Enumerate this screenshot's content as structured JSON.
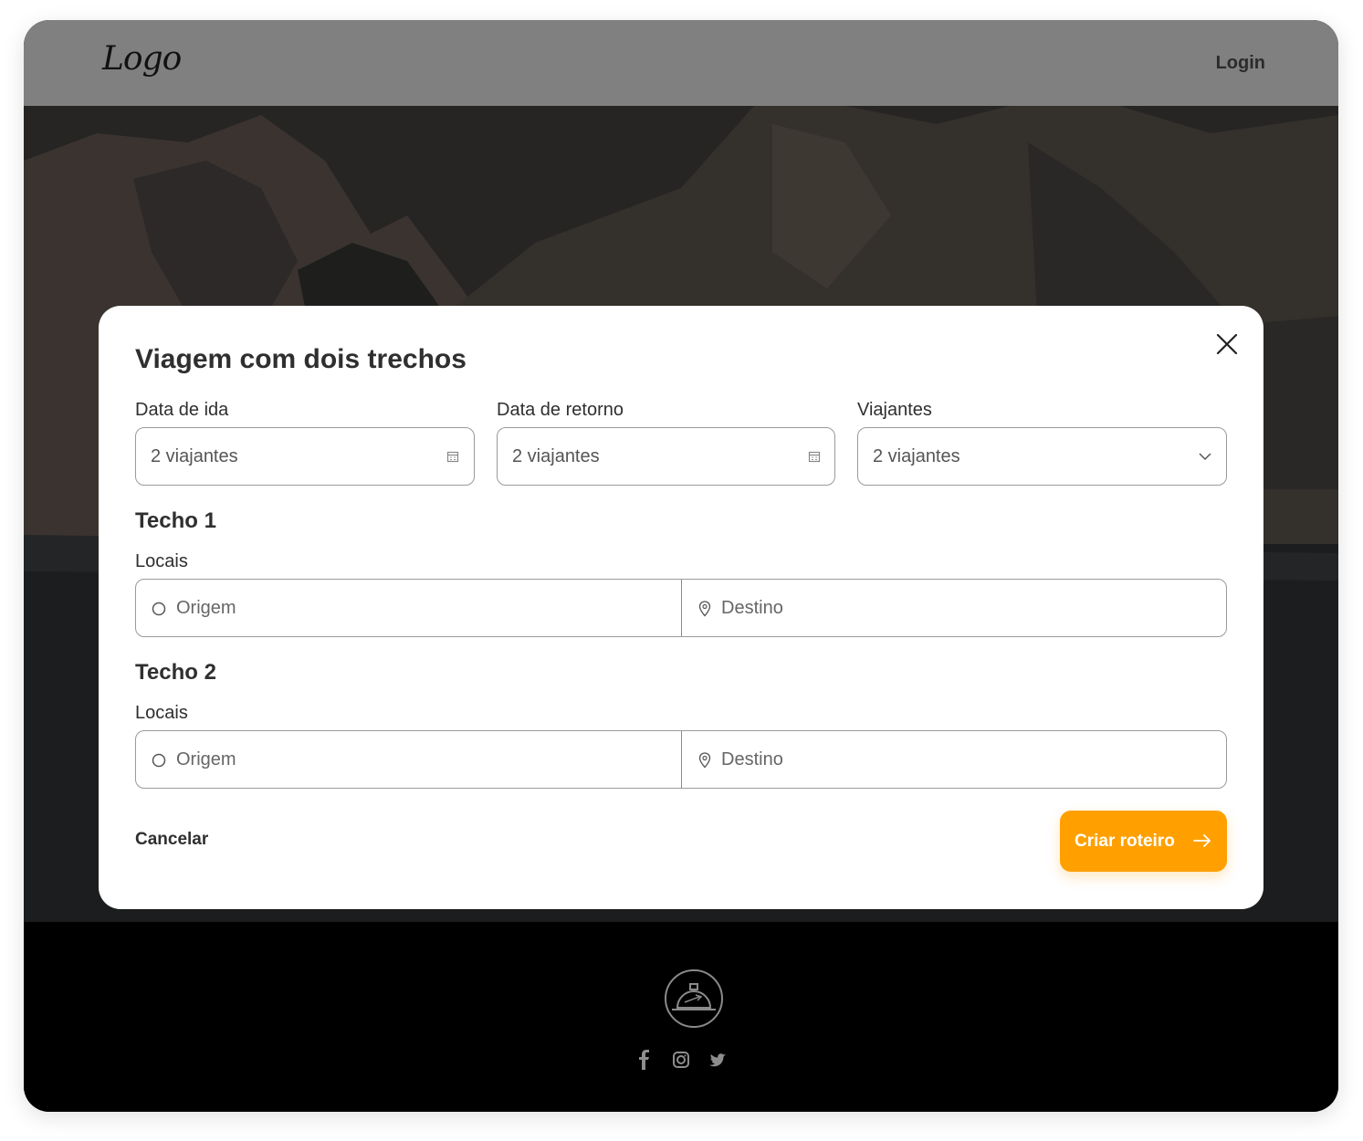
{
  "header": {
    "logo_text": "Logo",
    "login_label": "Login"
  },
  "modal": {
    "title": "Viagem com dois trechos",
    "fields": [
      {
        "label": "Data de ida",
        "value": "2 viajantes",
        "icon": "calendar-icon"
      },
      {
        "label": "Data de retorno",
        "value": "2 viajantes",
        "icon": "calendar-icon"
      },
      {
        "label": "Viajantes",
        "value": "2 viajantes",
        "icon": "chevron-down-icon"
      }
    ],
    "legs": [
      {
        "title": "Techo 1",
        "label": "Locais",
        "origin_placeholder": "Origem",
        "destination_placeholder": "Destino"
      },
      {
        "title": "Techo 2",
        "label": "Locais",
        "origin_placeholder": "Origem",
        "destination_placeholder": "Destino"
      }
    ],
    "cancel_label": "Cancelar",
    "submit_label": "Criar roteiro"
  },
  "footer": {
    "social_icons": [
      "facebook-icon",
      "instagram-icon",
      "twitter-icon"
    ]
  },
  "colors": {
    "accent": "#ffa000",
    "header_bg": "#808080",
    "footer_bg": "#000000"
  }
}
